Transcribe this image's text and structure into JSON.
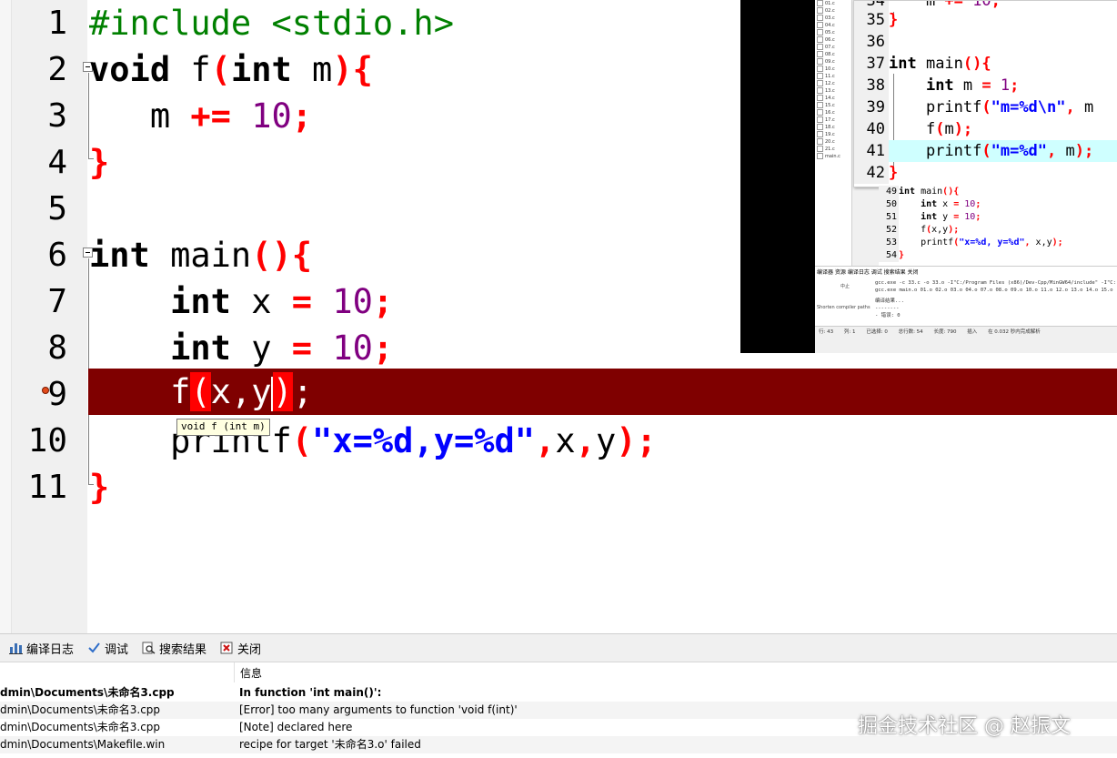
{
  "editor": {
    "line_numbers": [
      "1",
      "2",
      "3",
      "4",
      "5",
      "6",
      "7",
      "8",
      "9",
      "10",
      "11"
    ],
    "calltip": "void f (int m)"
  },
  "inset": {
    "tree_items": [
      "01.c",
      "02.c",
      "03.c",
      "04.c",
      "05.c",
      "06.c",
      "07.c",
      "08.c",
      "09.c",
      "10.c",
      "11.c",
      "12.c",
      "13.c",
      "14.c",
      "15.c",
      "16.c",
      "17.c",
      "18.c",
      "19.c",
      "20.c",
      "21.c",
      "main.c"
    ],
    "editor_line_numbers": [
      "34",
      "35",
      "36",
      "37",
      "38",
      "39",
      "40",
      "41",
      "42"
    ],
    "editor2_line_numbers": [
      "49",
      "50",
      "51",
      "52",
      "53",
      "54"
    ],
    "bottom_tabs": "编译器  资源  编译日志  调试  搜索结果  关闭",
    "compile_lines": [
      "gcc.exe -c 33.c -o 33.o -I\"C:/Program Files (x86)/Dev-Cpp/MinGW64/include\" -I\"C:",
      "gcc.exe main.o 01.o 02.o 03.o 04.o 07.o 08.o 09.o 10.o 11.o 12.o 13.o 14.o 15.o",
      "编译结果...",
      "--------",
      "- 错误: 0"
    ],
    "side_button": "中止",
    "side_checkbox": "Shorten compiler paths",
    "status": [
      "行: 43",
      "列: 1",
      "已选择: 0",
      "总行数: 54",
      "长度: 790",
      "插入",
      "在 0.032 秒内完成解析"
    ]
  },
  "bottom": {
    "tabs": [
      {
        "label": "编译日志",
        "icon": "bar-chart-icon"
      },
      {
        "label": "调试",
        "icon": "checkmark-icon"
      },
      {
        "label": "搜索结果",
        "icon": "search-document-icon"
      },
      {
        "label": "关闭",
        "icon": "close-icon"
      }
    ],
    "column_header": "信息",
    "rows": [
      {
        "file": "dmin\\Documents\\未命名3.cpp",
        "info": "In function 'int main()':",
        "bold": true
      },
      {
        "file": "dmin\\Documents\\未命名3.cpp",
        "info": "[Error] too many arguments to function 'void f(int)'",
        "bold": false
      },
      {
        "file": "dmin\\Documents\\未命名3.cpp",
        "info": "[Note] declared here",
        "bold": false
      },
      {
        "file": "dmin\\Documents\\Makefile.win",
        "info": "recipe for target '未命名3.o' failed",
        "bold": false
      }
    ]
  },
  "watermark": "掘金技术社区 @ 赵振文"
}
